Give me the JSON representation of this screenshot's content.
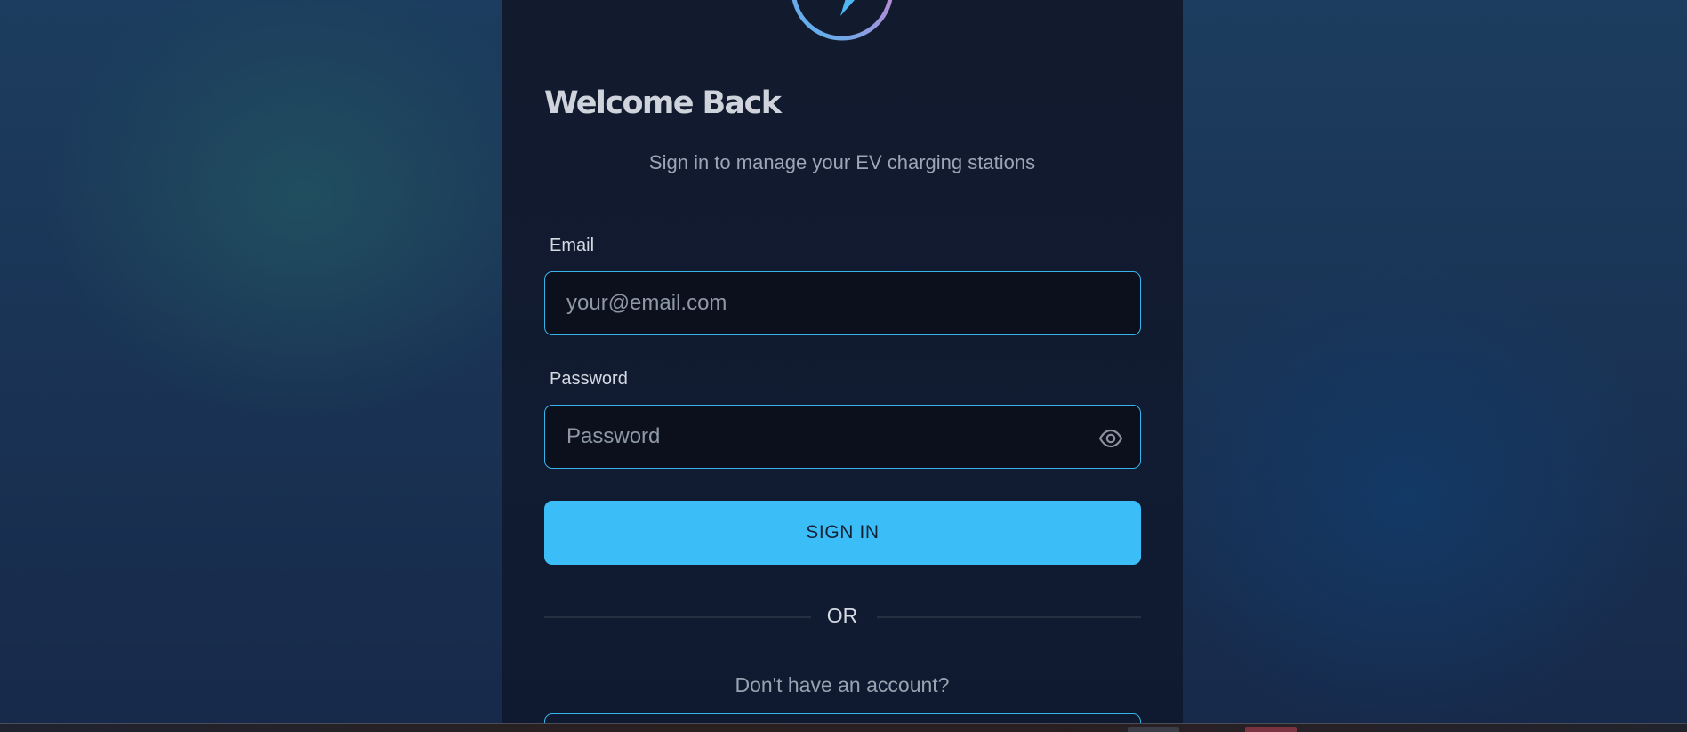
{
  "auth": {
    "title": "Welcome Back",
    "subtitle": "Sign in to manage your EV charging stations",
    "email_label": "Email",
    "email_placeholder": "your@email.com",
    "email_value": "",
    "password_label": "Password",
    "password_placeholder": "Password",
    "password_value": "",
    "password_toggle_icon": "eye-icon",
    "signin_label": "SIGN IN",
    "divider_text": "OR",
    "no_account_text": "Don't have an account?",
    "logo_icon": "lightning-bolt-icon"
  },
  "colors": {
    "accent": "#3bbdf7",
    "field_border": "#38b4ec",
    "logo_gradient_start": "#4fb6f2",
    "logo_gradient_end": "#e27ac8"
  }
}
